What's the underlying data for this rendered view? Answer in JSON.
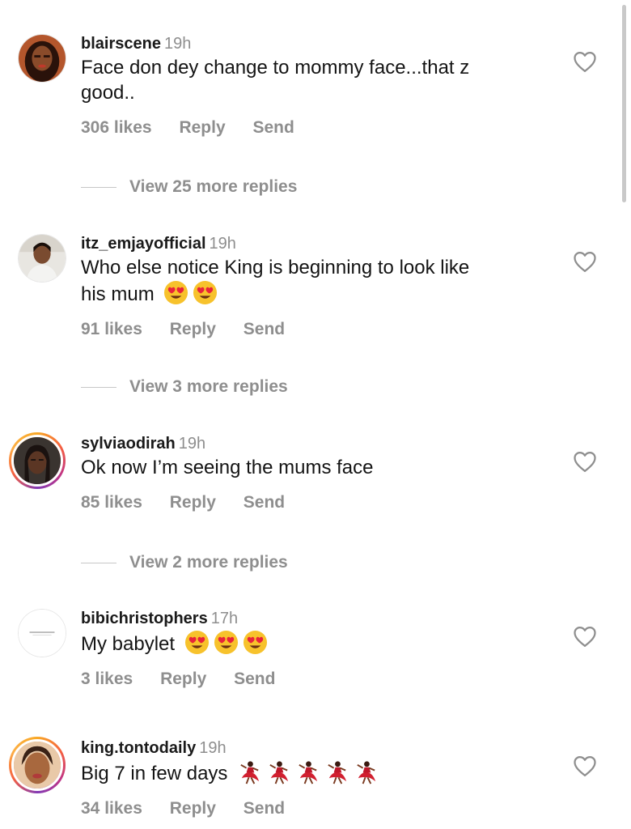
{
  "comments": [
    {
      "username": "blairscene",
      "time": "19h",
      "text_line1": "Face don dey change to mommy face...that z",
      "text_line2": "good..",
      "likes": "306 likes",
      "reply": "Reply",
      "send": "Send",
      "view_replies": "View 25 more replies",
      "avatar": "profile-photo",
      "emoji": []
    },
    {
      "username": "itz_emjayofficial",
      "time": "19h",
      "text_line1": "Who else notice King is beginning to look like",
      "text_line2": "his mum",
      "likes": "91 likes",
      "reply": "Reply",
      "send": "Send",
      "view_replies": "View 3 more replies",
      "avatar": "profile-photo",
      "emoji": [
        "heart-eyes",
        "heart-eyes"
      ]
    },
    {
      "username": "sylviaodirah",
      "time": "19h",
      "text_line1": "Ok now I’m seeing the mums face",
      "likes": "85 likes",
      "reply": "Reply",
      "send": "Send",
      "view_replies": "View 2 more replies",
      "avatar": "profile-photo-with-story-ring",
      "emoji": []
    },
    {
      "username": "bibichristophers",
      "time": "17h",
      "text_line1": "My babylet",
      "likes": "3 likes",
      "reply": "Reply",
      "send": "Send",
      "avatar": "brand-logo",
      "emoji": [
        "heart-eyes",
        "heart-eyes",
        "heart-eyes"
      ]
    },
    {
      "username": "king.tontodaily",
      "time": "19h",
      "text_line1": "Big 7 in few days",
      "likes": "34 likes",
      "reply": "Reply",
      "send": "Send",
      "avatar": "profile-photo-with-story-ring",
      "emoji": [
        "dancer",
        "dancer",
        "dancer",
        "dancer",
        "dancer"
      ]
    }
  ],
  "icons": {
    "like": "heart-outline-icon"
  },
  "colors": {
    "secondary_text": "#8e8e8e",
    "story_ring_start": "#f9a825",
    "story_ring_end": "#c13584"
  }
}
